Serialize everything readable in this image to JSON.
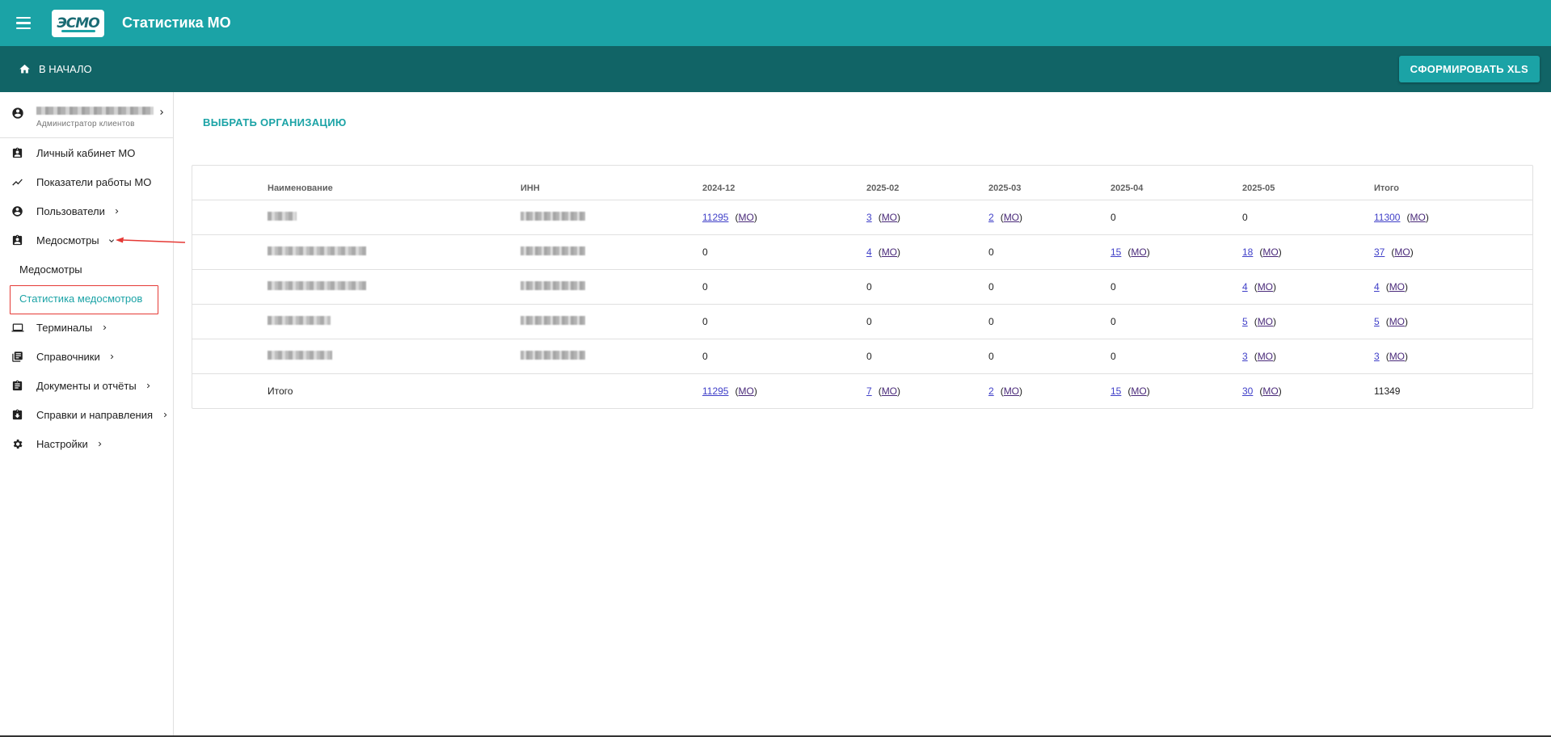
{
  "app": {
    "title": "Статистика МО",
    "logo_text": "ЭСМО"
  },
  "subbar": {
    "home_label": "В НАЧАЛО",
    "xls_button": "СФОРМИРОВАТЬ XLS"
  },
  "sidebar": {
    "user_role": "Администратор клиентов",
    "items": [
      {
        "label": "Личный кабинет МО",
        "icon": "assignment-ind-icon"
      },
      {
        "label": "Показатели работы МО",
        "icon": "trending-icon"
      },
      {
        "label": "Пользователи",
        "icon": "account-circle-icon"
      },
      {
        "label": "Медосмотры",
        "icon": "assignment-ind-icon"
      },
      {
        "label": "Терминалы",
        "icon": "laptop-icon"
      },
      {
        "label": "Справочники",
        "icon": "library-books-icon"
      },
      {
        "label": "Документы и отчёты",
        "icon": "assignment-icon"
      },
      {
        "label": "Справки и направления",
        "icon": "assignment-return-icon"
      },
      {
        "label": "Настройки",
        "icon": "gear-icon"
      }
    ],
    "subitems": [
      {
        "label": "Медосмотры"
      },
      {
        "label": "Статистика медосмотров"
      }
    ]
  },
  "main": {
    "choose_org": "ВЫБРАТЬ ОРГАНИЗАЦИЮ",
    "table": {
      "headers": [
        "Наименование",
        "ИНН",
        "2024-12",
        "2025-02",
        "2025-03",
        "2025-04",
        "2025-05",
        "Итого"
      ],
      "mo_label": "МО",
      "rows": [
        [
          "11295",
          "3",
          "2",
          "0",
          "0",
          "11300"
        ],
        [
          "0",
          "4",
          "0",
          "15",
          "18",
          "37"
        ],
        [
          "0",
          "0",
          "0",
          "0",
          "4",
          "4"
        ],
        [
          "0",
          "0",
          "0",
          "0",
          "5",
          "5"
        ],
        [
          "0",
          "0",
          "0",
          "0",
          "3",
          "3"
        ]
      ],
      "total_label": "Итого",
      "totals": [
        "11295",
        "7",
        "2",
        "15",
        "30",
        "11349"
      ]
    }
  },
  "colors": {
    "primary": "#1ba3a6",
    "dark": "#116466",
    "highlight": "#e53935"
  }
}
